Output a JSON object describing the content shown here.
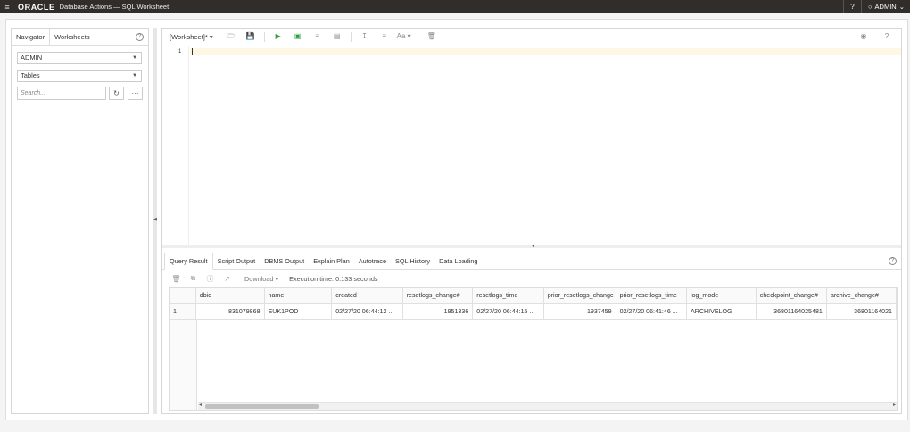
{
  "header": {
    "brand": "ORACLE",
    "title": "Database Actions — SQL Worksheet",
    "user": "ADMIN"
  },
  "navigator": {
    "tabs": [
      "Navigator",
      "Worksheets"
    ],
    "schema": "ADMIN",
    "object_type": "Tables",
    "search_placeholder": "Search..."
  },
  "editor": {
    "worksheet_label": "[Worksheet]*",
    "line_number": "1"
  },
  "results": {
    "tabs": [
      "Query Result",
      "Script Output",
      "DBMS Output",
      "Explain Plan",
      "Autotrace",
      "SQL History",
      "Data Loading"
    ],
    "download_label": "Download",
    "execution_time": "Execution time: 0.133 seconds",
    "columns": [
      "dbid",
      "name",
      "created",
      "resetlogs_change#",
      "resetlogs_time",
      "prior_resetlogs_change",
      "prior_resetlogs_time",
      "log_mode",
      "checkpoint_change#",
      "archive_change#"
    ],
    "rows": [
      {
        "rownum": "1",
        "cells": [
          "831079868",
          "EUK1POD",
          "02/27/20 06:44:12 ...",
          "1951336",
          "02/27/20 06:44:15 ...",
          "1937459",
          "02/27/20 06:41:46 ...",
          "ARCHIVELOG",
          "36801164025481",
          "36801164021"
        ]
      }
    ]
  }
}
